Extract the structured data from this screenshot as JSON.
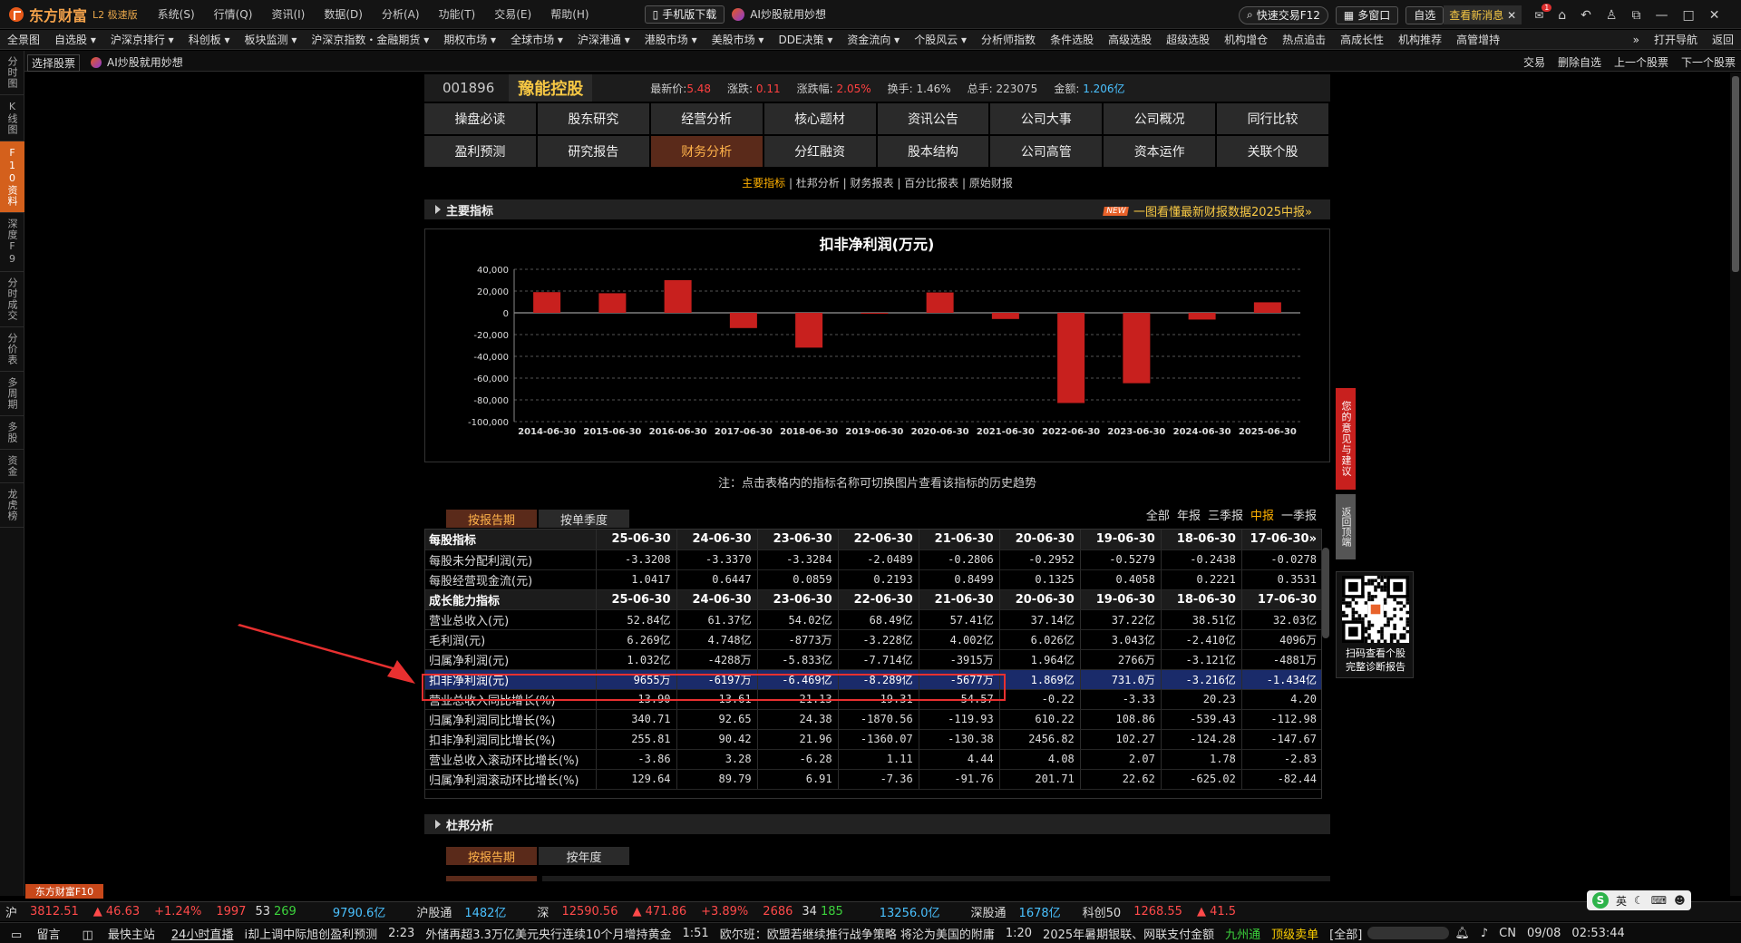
{
  "app": {
    "name": "东方财富",
    "edition": "L2 极速版"
  },
  "title_menu": [
    "系统(S)",
    "行情(Q)",
    "资讯(I)",
    "数据(D)",
    "分析(A)",
    "功能(T)",
    "交易(E)",
    "帮助(H)"
  ],
  "title_buttons": {
    "mobile": "手机版下载",
    "ai": "AI炒股就用妙想",
    "quick_trade": "快速交易F12",
    "multi_window": "多窗口",
    "self": "自选",
    "news": "查看新消息",
    "badge": "1"
  },
  "nav_items": [
    "全景图",
    "自选股 ▾",
    "沪深京排行 ▾",
    "科创板 ▾",
    "板块监测 ▾",
    "沪深京指数・金融期货 ▾",
    "期权市场 ▾",
    "全球市场 ▾",
    "沪深港通 ▾",
    "港股市场 ▾",
    "美股市场 ▾",
    "DDE决策 ▾",
    "资金流向 ▾",
    "个股风云 ▾",
    "分析师指数",
    "条件选股",
    "高级选股",
    "超级选股",
    "机构增仓",
    "热点追击",
    "高成长性",
    "机构推荐",
    "高管增持",
    "»",
    "打开导航",
    "返回"
  ],
  "subbar": {
    "select": "选择股票",
    "ai": "AI炒股就用妙想",
    "right": [
      "交易",
      "删除自选",
      "上一个股票",
      "下一个股票"
    ]
  },
  "left_rail": [
    "分时图",
    "K线图",
    "F10资料",
    "深度F9",
    "分时成交",
    "分价表",
    "多周期",
    "多股",
    "资金",
    "龙虎榜"
  ],
  "stock": {
    "code": "001896",
    "name": "豫能控股",
    "price_label": "最新价:",
    "price": "5.48",
    "chg_label": "涨跌:",
    "chg": "0.11",
    "pct_label": "涨跌幅:",
    "pct": "2.05%",
    "turnover_label": "换手:",
    "turnover": "1.46%",
    "vol_label": "总手:",
    "vol": "223075",
    "amt_label": "金额:",
    "amt": "1.206亿"
  },
  "tabs_row1": [
    "操盘必读",
    "股东研究",
    "经营分析",
    "核心题材",
    "资讯公告",
    "公司大事",
    "公司概况",
    "同行比较"
  ],
  "tabs_row2": [
    "盈利预测",
    "研究报告",
    "财务分析",
    "分红融资",
    "股本结构",
    "公司高管",
    "资本运作",
    "关联个股"
  ],
  "sublinks": [
    "主要指标",
    "杜邦分析",
    "财务报表",
    "百分比报表",
    "原始财报"
  ],
  "section_main": {
    "title": "主要指标",
    "new": "NEW",
    "link": "一图看懂最新财报数据2025中报»"
  },
  "chart_data": {
    "type": "bar",
    "title": "扣非净利润(万元)",
    "categories": [
      "2014-06-30",
      "2015-06-30",
      "2016-06-30",
      "2017-06-30",
      "2018-06-30",
      "2019-06-30",
      "2020-06-30",
      "2021-06-30",
      "2022-06-30",
      "2023-06-30",
      "2024-06-30",
      "2025-06-30"
    ],
    "values": [
      19000,
      18000,
      30000,
      -14000,
      -32000,
      -800,
      18700,
      -5677,
      -82890,
      -64690,
      -6197,
      9655
    ],
    "ylim": [
      -100000,
      40000
    ],
    "yticks": [
      "40,000",
      "20,000",
      "0",
      "-20,000",
      "-40,000",
      "-60,000",
      "-80,000",
      "-100,000"
    ],
    "grid": true,
    "colors": {
      "bar": "#c8201e"
    }
  },
  "note": "注：点击表格内的指标名称可切换图片查看该指标的历史趋势",
  "period_tabs": [
    "按报告期",
    "按单季度"
  ],
  "filters": [
    "全部",
    "年报",
    "三季报",
    "中报",
    "一季报"
  ],
  "table": {
    "header1": [
      "每股指标",
      "25-06-30",
      "24-06-30",
      "23-06-30",
      "22-06-30",
      "21-06-30",
      "20-06-30",
      "19-06-30",
      "18-06-30",
      "17-06-30»"
    ],
    "rows1": [
      [
        "每股未分配利润(元)",
        "-3.3208",
        "-3.3370",
        "-3.3284",
        "-2.0489",
        "-0.2806",
        "-0.2952",
        "-0.5279",
        "-0.2438",
        "-0.0278"
      ],
      [
        "每股经营现金流(元)",
        "1.0417",
        "0.6447",
        "0.0859",
        "0.2193",
        "0.8499",
        "0.1325",
        "0.4058",
        "0.2221",
        "0.3531"
      ]
    ],
    "header2": [
      "成长能力指标",
      "25-06-30",
      "24-06-30",
      "23-06-30",
      "22-06-30",
      "21-06-30",
      "20-06-30",
      "19-06-30",
      "18-06-30",
      "17-06-30"
    ],
    "rows2": [
      [
        "营业总收入(元)",
        "52.84亿",
        "61.37亿",
        "54.02亿",
        "68.49亿",
        "57.41亿",
        "37.14亿",
        "37.22亿",
        "38.51亿",
        "32.03亿"
      ],
      [
        "毛利润(元)",
        "6.269亿",
        "4.748亿",
        "-8773万",
        "-3.228亿",
        "4.002亿",
        "6.026亿",
        "3.043亿",
        "-2.410亿",
        "4096万"
      ],
      [
        "归属净利润(元)",
        "1.032亿",
        "-4288万",
        "-5.833亿",
        "-7.714亿",
        "-3915万",
        "1.964亿",
        "2766万",
        "-3.121亿",
        "-4881万"
      ],
      [
        "扣非净利润(元)",
        "9655万",
        "-6197万",
        "-6.469亿",
        "-8.289亿",
        "-5677万",
        "1.869亿",
        "731.0万",
        "-3.216亿",
        "-1.434亿"
      ],
      [
        "营业总收入同比增长(%)",
        "-13.90",
        "13.61",
        "-21.13",
        "19.31",
        "54.57",
        "-0.22",
        "-3.33",
        "20.23",
        "4.20"
      ],
      [
        "归属净利润同比增长(%)",
        "340.71",
        "92.65",
        "24.38",
        "-1870.56",
        "-119.93",
        "610.22",
        "108.86",
        "-539.43",
        "-112.98"
      ],
      [
        "扣非净利润同比增长(%)",
        "255.81",
        "90.42",
        "21.96",
        "-1360.07",
        "-130.38",
        "2456.82",
        "102.27",
        "-124.28",
        "-147.67"
      ],
      [
        "营业总收入滚动环比增长(%)",
        "-3.86",
        "3.28",
        "-6.28",
        "1.11",
        "4.44",
        "4.08",
        "2.07",
        "1.78",
        "-2.83"
      ],
      [
        "归属净利润滚动环比增长(%)",
        "129.64",
        "89.79",
        "6.91",
        "-7.36",
        "-91.76",
        "201.71",
        "22.62",
        "-625.02",
        "-82.44"
      ]
    ]
  },
  "section_dupont": {
    "title": "杜邦分析"
  },
  "period_tabs2": [
    "按报告期",
    "按年度"
  ],
  "side": {
    "feedback": "您的意见与建议",
    "backtop": "返回顶端",
    "qr_caption1": "扫码查看个股",
    "qr_caption2": "完整诊断报告"
  },
  "f10tab": "东方财富F10",
  "ticker1": {
    "sh": "沪",
    "sh_idx": "3812.51",
    "sh_chg": "▲ 46.63",
    "sh_pct": "+1.24%",
    "sh_up": "1997",
    "sh_flat": "53",
    "sh_down": "269",
    "sh_amt": "9790.6亿",
    "hgt": "沪股通",
    "hgt_amt": "1482亿",
    "sz": "深",
    "sz_idx": "12590.56",
    "sz_chg": "▲ 471.86",
    "sz_pct": "+3.89%",
    "sz_up": "2686",
    "sz_flat": "34",
    "sz_down": "185",
    "sz_amt": "13256.0亿",
    "sgt": "深股通",
    "sgt_amt": "1678亿",
    "kc": "科创50",
    "kc_idx": "1268.55",
    "kc_chg": "▲ 41.5"
  },
  "ticker2": {
    "msg": "留言",
    "fast": "最快主站",
    "live": "24小时直播",
    "n1": "i却上调中际旭创盈利预测",
    "t1": "2:23",
    "n2": "外储再超3.3万亿美元央行连续10个月增持黄金",
    "t2": "1:51",
    "n3": "欧尔班：欧盟若继续推行战争策略 将沦为美国的附庸",
    "t3": "1:20",
    "n4": "2025年暑期银联、网联支付金额",
    "s1": "九州通",
    "s2": "顶级卖单",
    "all": "[全部]",
    "ime": "英",
    "cn": "CN",
    "date": "09/08",
    "time": "02:53:44"
  }
}
